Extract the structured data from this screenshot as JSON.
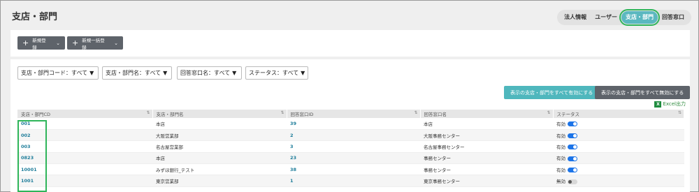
{
  "page": {
    "title": "支店・部門"
  },
  "tabs": [
    {
      "label": "法人情報",
      "active": false
    },
    {
      "label": "ユーザー",
      "active": false
    },
    {
      "label": "支店・部門",
      "active": true
    },
    {
      "label": "回答窓口",
      "active": false
    }
  ],
  "toolbar": {
    "new_label": "新規登録",
    "bulk_label": "新規一括登録"
  },
  "filters": [
    {
      "label": "支店・部門コード：すべて"
    },
    {
      "label": "支店・部門名：すべて"
    },
    {
      "label": "回答窓口名：すべて"
    },
    {
      "label": "ステータス：すべて"
    }
  ],
  "actions": {
    "enable_all": "表示の支店・部門をすべて有効にする",
    "disable_all": "表示の支店・部門をすべて無効にする",
    "excel": "Excel出力"
  },
  "table": {
    "headers": [
      "支店・部門CD",
      "支店・部門名",
      "回答窓口ID",
      "回答窓口名",
      "ステータス"
    ],
    "rows": [
      {
        "code": "001",
        "name": "本店",
        "window_id": "39",
        "window_name": "本店",
        "status": "有効",
        "enabled": true
      },
      {
        "code": "002",
        "name": "大阪営業部",
        "window_id": "2",
        "window_name": "大阪事務センター",
        "status": "有効",
        "enabled": true
      },
      {
        "code": "003",
        "name": "名古屋営業部",
        "window_id": "3",
        "window_name": "名古屋事務センター",
        "status": "有効",
        "enabled": true
      },
      {
        "code": "0823",
        "name": "本店",
        "window_id": "23",
        "window_name": "事務センター",
        "status": "有効",
        "enabled": true
      },
      {
        "code": "10001",
        "name": "みずほ銀行_テスト",
        "window_id": "38",
        "window_name": "事務センター",
        "status": "有効",
        "enabled": true
      },
      {
        "code": "1001",
        "name": "東京営業部",
        "window_id": "1",
        "window_name": "東京事務センター",
        "status": "無効",
        "enabled": false
      }
    ]
  },
  "colors": {
    "accent": "#4fb7bd",
    "highlight": "#2fb55a",
    "toggle_on": "#1c74e8"
  }
}
